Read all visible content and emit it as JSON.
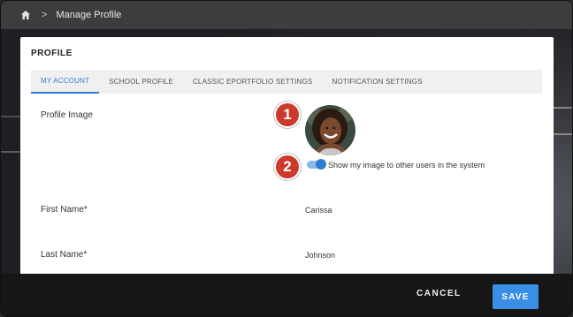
{
  "topbar": {
    "breadcrumb_separator": ">",
    "breadcrumb_label": "Manage Profile"
  },
  "dialog": {
    "title": "PROFILE",
    "tabs": [
      {
        "label": "MY ACCOUNT",
        "active": true
      },
      {
        "label": "SCHOOL PROFILE",
        "active": false
      },
      {
        "label": "CLASSIC EPORTFOLIO SETTINGS",
        "active": false
      },
      {
        "label": "NOTIFICATION SETTINGS",
        "active": false
      }
    ],
    "profile_image_label": "Profile Image",
    "show_image_toggle": {
      "label": "Show my image to other users in the system",
      "on": true
    },
    "first_name": {
      "label": "First Name*",
      "value": "Carissa"
    },
    "last_name": {
      "label": "Last Name*",
      "value": "Johnson"
    }
  },
  "callouts": {
    "one": "1",
    "two": "2"
  },
  "footer": {
    "cancel_label": "CANCEL",
    "save_label": "SAVE"
  },
  "colors": {
    "accent": "#2f7dd1",
    "save_button": "#3a8ee6",
    "callout": "#cc3a2c"
  },
  "icons": {
    "home": "home-icon"
  }
}
